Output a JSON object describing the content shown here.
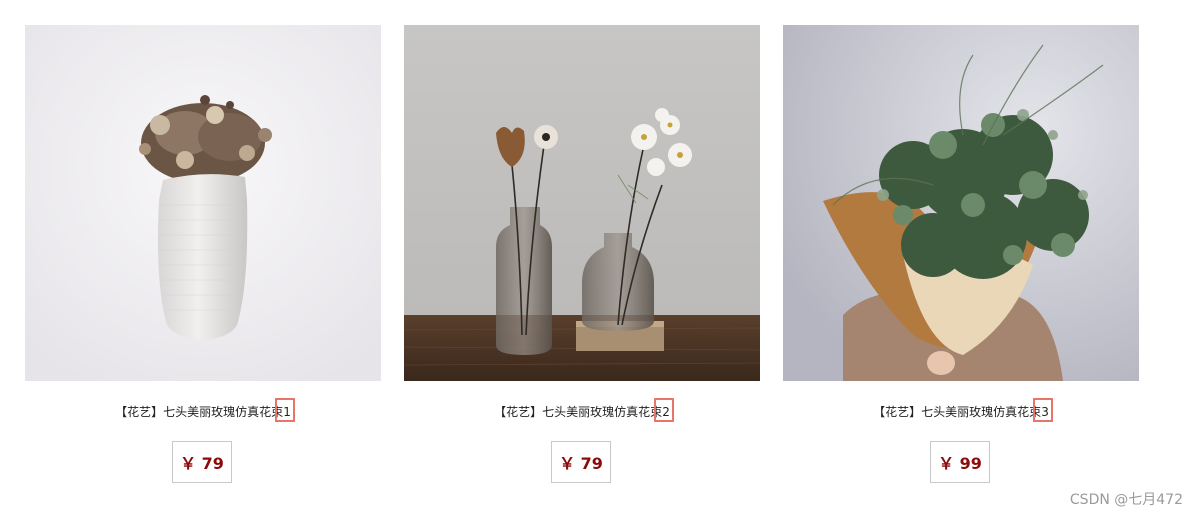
{
  "products": [
    {
      "title_prefix": "【花艺】七头美丽玫瑰仿真花束",
      "title_num": "1",
      "price": "￥ 79",
      "image": "white-vase-dried-flowers"
    },
    {
      "title_prefix": "【花艺】七头美丽玫瑰仿真花束",
      "title_num": "2",
      "price": "￥ 79",
      "image": "glass-vases-on-wood-table"
    },
    {
      "title_prefix": "【花艺】七头美丽玫瑰仿真花束",
      "title_num": "3",
      "price": "￥ 99",
      "image": "eucalyptus-bouquet"
    }
  ],
  "watermark": "CSDN @七月472"
}
